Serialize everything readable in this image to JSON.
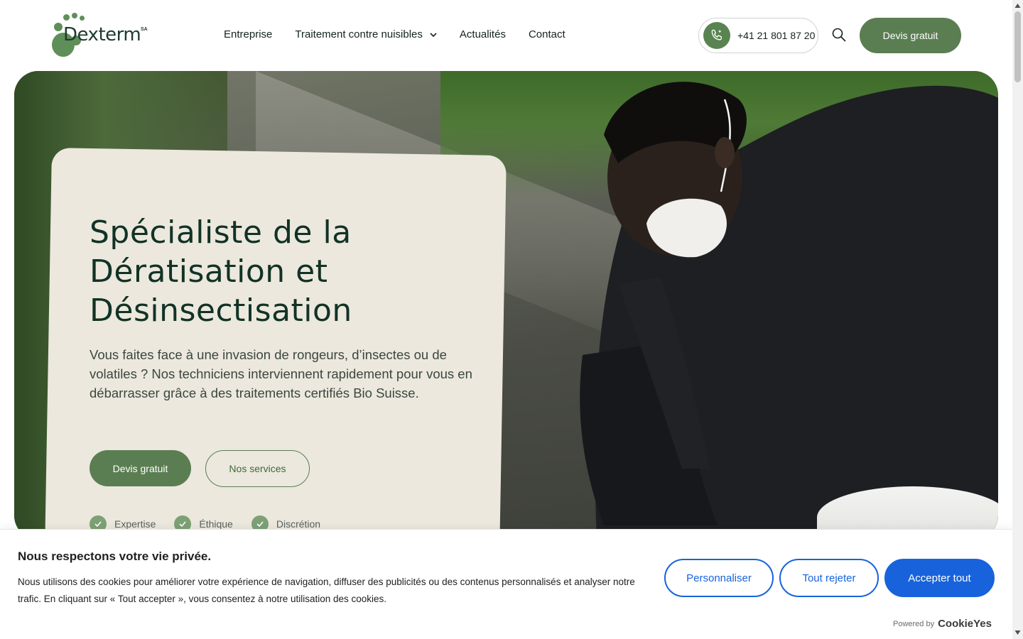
{
  "brand": {
    "name": "Dexterm",
    "suffix": "SA",
    "primary_color": "#5a7e52",
    "dark_color": "#123226",
    "cream_color": "#ece8dd"
  },
  "nav": {
    "items": [
      {
        "label": "Entreprise"
      },
      {
        "label": "Traitement contre nuisibles",
        "has_dropdown": true
      },
      {
        "label": "Actualités"
      },
      {
        "label": "Contact"
      }
    ]
  },
  "header": {
    "phone": "+41 21 801 87 20",
    "quote_label": "Devis gratuit",
    "phone_icon": "phone-icon",
    "search_icon": "search-icon"
  },
  "hero": {
    "title": "Spécialiste de la Dératisation et Désinsectisation",
    "description": "Vous faites face à une invasion de rongeurs, d’insectes ou de volatiles ?  Nos techniciens interviennent rapidement pour vous en débarrasser grâce à des traitements certifiés Bio Suisse.",
    "primary_button": "Devis gratuit",
    "secondary_button": "Nos services",
    "badges": [
      "Expertise",
      "Éthique",
      "Discrétion"
    ]
  },
  "cookie": {
    "title": "Nous respectons votre vie privée.",
    "text": "Nous utilisons des cookies pour améliorer votre expérience de navigation, diffuser des publicités ou des contenus personnalisés et analyser notre trafic. En cliquant sur « Tout accepter », vous consentez à notre utilisation des cookies.",
    "customize": "Personnaliser",
    "reject": "Tout rejeter",
    "accept": "Accepter tout",
    "powered_by": "Powered by",
    "powered_brand": "CookieYes",
    "accent_color": "#1863dc"
  }
}
